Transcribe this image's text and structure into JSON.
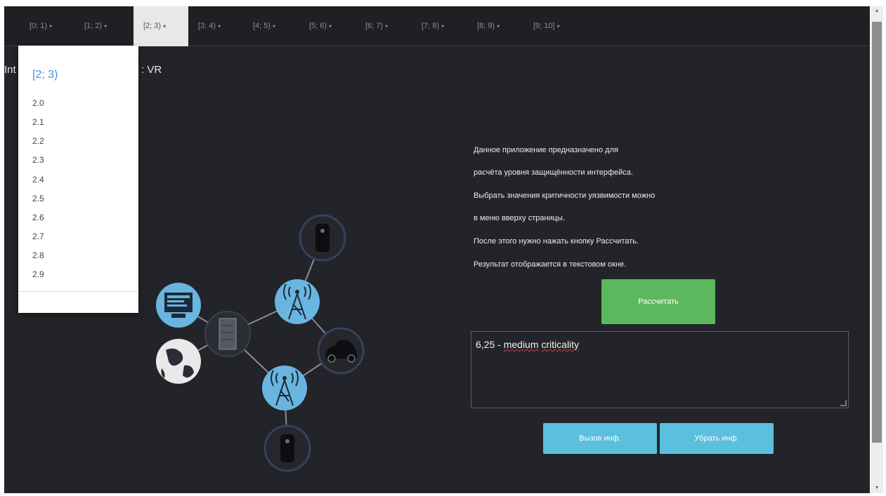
{
  "nav": {
    "items": [
      {
        "label": "[0; 1)"
      },
      {
        "label": "[1; 2)"
      },
      {
        "label": "[2; 3)"
      },
      {
        "label": "[3; 4)"
      },
      {
        "label": "[4; 5)"
      },
      {
        "label": "[5; 6)"
      },
      {
        "label": "[6; 7)"
      },
      {
        "label": "[7; 8)"
      },
      {
        "label": "[8; 9)"
      },
      {
        "label": "[9; 10]"
      }
    ],
    "active_index": 2,
    "caret": "▾"
  },
  "title_fragments": {
    "left": "Int",
    "right": ": VR"
  },
  "dropdown": {
    "header": "[2; 3)",
    "items": [
      "2.0",
      "2.1",
      "2.2",
      "2.3",
      "2.4",
      "2.5",
      "2.6",
      "2.7",
      "2.8",
      "2.9"
    ]
  },
  "info": {
    "lines": [
      "Данное приложение предназначено для",
      "расчёта уровня защищённости интерфейса.",
      "Выбрать значения критичности уязвимости можно",
      "в меню вверху страницы.",
      "После этого нужно нажать кнопку Рассчитать.",
      "Результат отображается в текстовом окне."
    ]
  },
  "calc_button": {
    "label": "Рассчитать"
  },
  "result": {
    "value": "6,25 - ",
    "word1": "medium",
    "word2": "criticality"
  },
  "buttons": {
    "show_info": "Вызов инф.",
    "hide_info": "Убрать инф."
  },
  "diagram": {
    "icons": [
      "computer-icon",
      "globe-icon",
      "server-icon",
      "antenna-tower-icon",
      "antenna-tower-icon",
      "phone-icon",
      "phone-icon",
      "car-icon"
    ]
  },
  "colors": {
    "background": "#222429",
    "navbar": "#1e2024",
    "accent_blue": "#4a8fd6",
    "button_green": "#5cb85c",
    "button_info": "#5bc0de",
    "node_blue": "#6ab4e0"
  }
}
